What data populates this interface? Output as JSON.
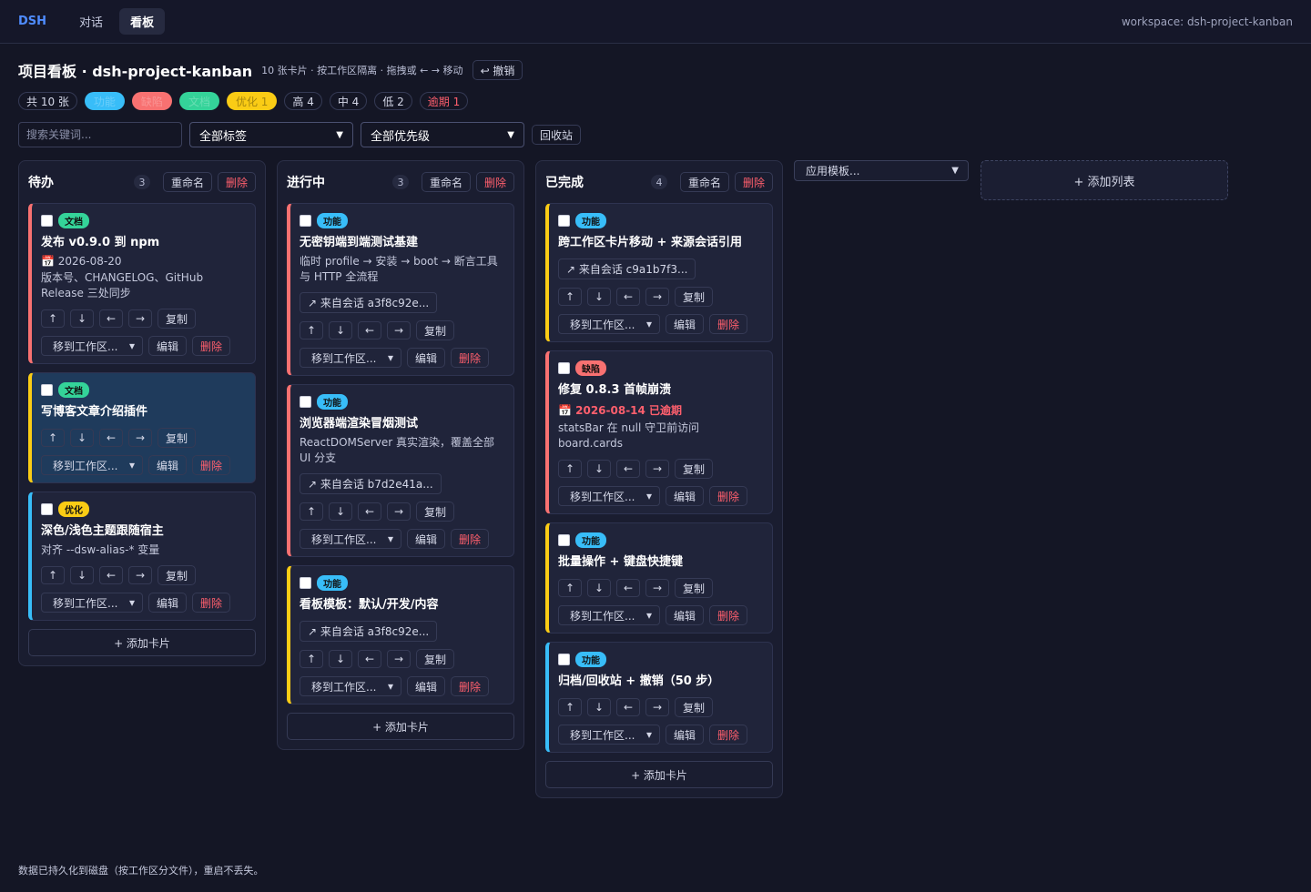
{
  "nav": {
    "brand": "DSH",
    "tabs": [
      {
        "label": "对话"
      },
      {
        "label": "看板"
      }
    ],
    "active_tab": "看板",
    "workspace": "workspace: dsh-project-kanban"
  },
  "header": {
    "title": "项目看板 · dsh-project-kanban",
    "subtitle": "10 张卡片 · 按工作区隔离 · 拖拽或 ← → 移动",
    "undo_label": "↩ 撤销"
  },
  "stats": {
    "total": "共 10 张",
    "tag_chips": [
      {
        "label": "功能",
        "color": "#38bdf8"
      },
      {
        "label": "缺陷",
        "color": "#f87171"
      },
      {
        "label": "文档",
        "color": "#34d399"
      },
      {
        "label": "优化 1",
        "color": "#facc15"
      }
    ],
    "priority_high": "高 4",
    "priority_mid": "中 4",
    "priority_low": "低 2",
    "overdue": "逾期 1"
  },
  "filters": {
    "search_placeholder": "搜索关键词...",
    "tag_select": "全部标签",
    "priority_select": "全部优先级",
    "recycle_label": "回收站"
  },
  "labels": {
    "rename": "重命名",
    "delete": "删除",
    "copy": "复制",
    "edit": "编辑",
    "move_to": "移到工作区...",
    "add_card": "+ 添加卡片",
    "up": "↑",
    "down": "↓",
    "left": "←",
    "right": "→"
  },
  "colors": {
    "feature": "#38bdf8",
    "bug": "#f87171",
    "doc": "#34d399",
    "opt": "#facc15",
    "priority_high": "#f87171",
    "priority_mid": "#facc15",
    "priority_low": "#38bdf8"
  },
  "columns": [
    {
      "title": "待办",
      "count": "3",
      "cards": [
        {
          "tag": "文档",
          "title": "发布 v0.9.0 到 npm",
          "date": "📅 2026-08-20",
          "desc": "版本号、CHANGELOG、GitHub Release 三处同步",
          "priority": "high"
        },
        {
          "tag": "文档",
          "title": "写博客文章介绍插件",
          "priority": "mid",
          "selected": true
        },
        {
          "tag": "优化",
          "title": "深色/浅色主题跟随宿主",
          "desc": "对齐 --dsw-alias-* 变量",
          "priority": "low"
        }
      ]
    },
    {
      "title": "进行中",
      "count": "3",
      "cards": [
        {
          "tag": "功能",
          "title": "无密钥端到端测试基建",
          "desc": "临时 profile → 安装 → boot → 断言工具 与 HTTP 全流程",
          "source": "↗ 来自会话 a3f8c92e...",
          "priority": "high"
        },
        {
          "tag": "功能",
          "title": "浏览器端渲染冒烟测试",
          "desc": "ReactDOMServer 真实渲染，覆盖全部 UI 分支",
          "source": "↗ 来自会话 b7d2e41a...",
          "priority": "high"
        },
        {
          "tag": "功能",
          "title": "看板模板：默认/开发/内容",
          "source": "↗ 来自会话 a3f8c92e...",
          "priority": "mid"
        }
      ]
    },
    {
      "title": "已完成",
      "count": "4",
      "cards": [
        {
          "tag": "功能",
          "title": "跨工作区卡片移动 + 来源会话引用",
          "source": "↗ 来自会话 c9a1b7f3...",
          "priority": "mid"
        },
        {
          "tag": "缺陷",
          "title": "修复 0.8.3 首帧崩溃",
          "date": "📅 2026-08-14 已逾期",
          "overdue": true,
          "desc": "statsBar 在 null 守卫前访问 board.cards",
          "priority": "high"
        },
        {
          "tag": "功能",
          "title": "批量操作 + 键盘快捷键",
          "priority": "mid"
        },
        {
          "tag": "功能",
          "title": "归档/回收站 + 撤销（50 步）",
          "priority": "low"
        }
      ]
    }
  ],
  "template_select": "应用模板...",
  "add_list": "+ 添加列表",
  "footer": "数据已持久化到磁盘（按工作区分文件），重启不丢失。"
}
